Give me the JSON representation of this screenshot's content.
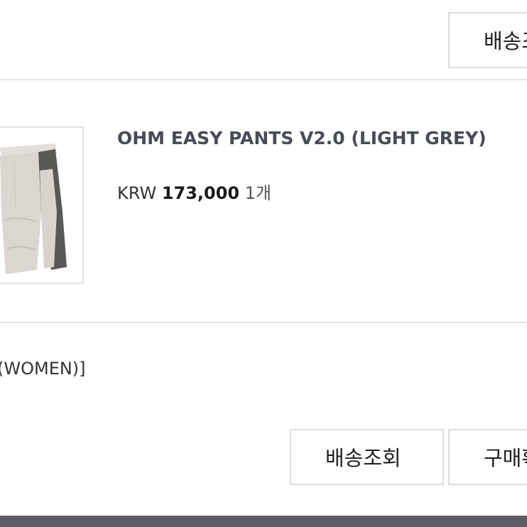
{
  "top": {
    "delivery_button": "배송조회"
  },
  "product": {
    "name": "OHM EASY PANTS V2.0 (LIGHT GREY)",
    "currency": "KRW",
    "price": "173,000",
    "quantity": "1개",
    "image_icon": "pants-thumbnail-icon"
  },
  "option_text": "(WOMEN)]",
  "actions": {
    "delivery_track": "배송조회",
    "purchase_confirm": "구매확정"
  },
  "colors": {
    "border": "#dcdcdc",
    "title": "#484c58",
    "footer": "#5d5e65"
  }
}
